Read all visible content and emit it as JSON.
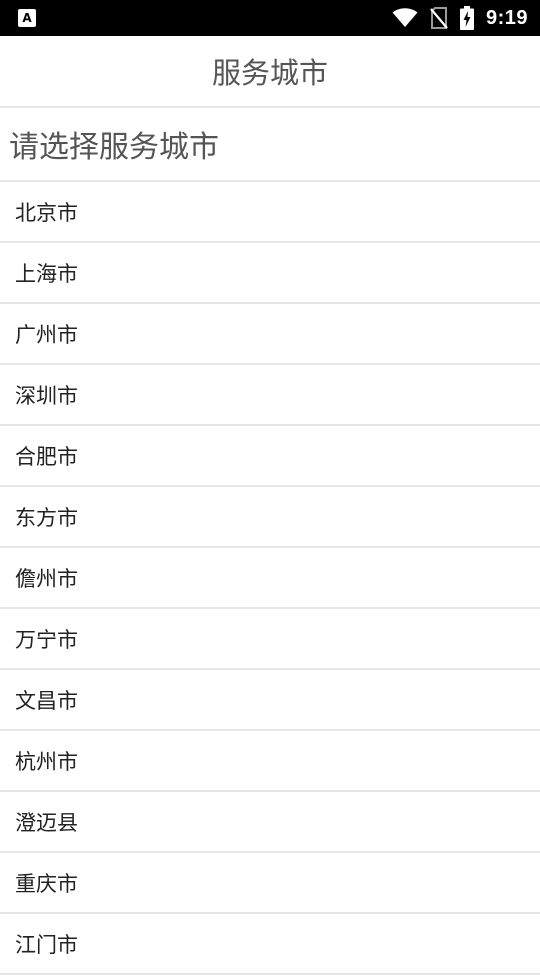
{
  "status_bar": {
    "time": "9:19",
    "left_icon": "A"
  },
  "header": {
    "title": "服务城市"
  },
  "section": {
    "title": "请选择服务城市"
  },
  "cities": [
    "北京市",
    "上海市",
    "广州市",
    "深圳市",
    "合肥市",
    "东方市",
    "儋州市",
    "万宁市",
    "文昌市",
    "杭州市",
    "澄迈县",
    "重庆市",
    "江门市"
  ],
  "colors": {
    "status_bar_bg": "#000000",
    "divider": "#e6e6e6",
    "title_text": "#555555",
    "item_text": "#222222"
  },
  "icons": [
    "app-notification-icon",
    "wifi-icon",
    "no-sim-icon",
    "battery-charging-icon"
  ]
}
